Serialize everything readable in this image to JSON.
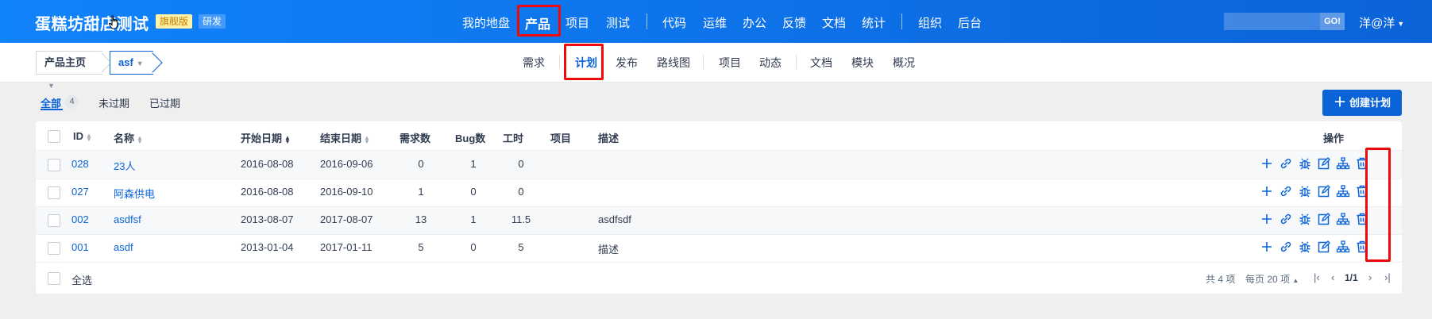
{
  "header": {
    "brand": "蛋糕坊甜店测试",
    "edition_tag": "旗舰版",
    "mode_tag": "研发",
    "nav": [
      {
        "label": "我的地盘"
      },
      {
        "label": "产品",
        "active": true
      },
      {
        "label": "项目"
      },
      {
        "label": "测试"
      },
      {
        "label": "代码"
      },
      {
        "label": "运维"
      },
      {
        "label": "办公"
      },
      {
        "label": "反馈"
      },
      {
        "label": "文档"
      },
      {
        "label": "统计"
      },
      {
        "label": "组织"
      },
      {
        "label": "后台"
      }
    ],
    "search_value": "",
    "search_button": "GO!",
    "user": "洋@洋"
  },
  "breadcrumb": {
    "product_home": "产品主页",
    "product_name": "asf"
  },
  "subnav": [
    {
      "label": "需求"
    },
    {
      "label": "计划",
      "active": true
    },
    {
      "label": "发布"
    },
    {
      "label": "路线图"
    },
    {
      "label": "项目"
    },
    {
      "label": "动态"
    },
    {
      "label": "文档"
    },
    {
      "label": "模块"
    },
    {
      "label": "概况"
    }
  ],
  "filters": {
    "all": "全部",
    "all_count": "4",
    "unexpired": "未过期",
    "expired": "已过期",
    "create_button": "创建计划"
  },
  "table": {
    "columns": [
      "ID",
      "名称",
      "开始日期",
      "结束日期",
      "需求数",
      "Bug数",
      "工时",
      "项目",
      "描述",
      "操作"
    ],
    "rows": [
      {
        "id": "028",
        "name": "23人",
        "start": "2016-08-08",
        "end": "2016-09-06",
        "stories": "0",
        "bugs": "1",
        "hours": "0",
        "project": "",
        "desc": ""
      },
      {
        "id": "027",
        "name": "阿森供电",
        "start": "2016-08-08",
        "end": "2016-09-10",
        "stories": "1",
        "bugs": "0",
        "hours": "0",
        "project": "",
        "desc": ""
      },
      {
        "id": "002",
        "name": "asdfsf",
        "start": "2013-08-07",
        "end": "2017-08-07",
        "stories": "13",
        "bugs": "1",
        "hours": "11.5",
        "project": "",
        "desc": "asdfsdf"
      },
      {
        "id": "001",
        "name": "asdf",
        "start": "2013-01-04",
        "end": "2017-01-11",
        "stories": "5",
        "bugs": "0",
        "hours": "5",
        "project": "",
        "desc": "描述"
      }
    ],
    "actions": [
      "plus-icon",
      "link-icon",
      "bug-icon",
      "edit-icon",
      "hierarchy-icon",
      "trash-icon"
    ]
  },
  "footer": {
    "select_all": "全选",
    "total": "共 4 项",
    "per_page": "每页 20 项",
    "page": "1/1"
  },
  "colors": {
    "primary": "#0b63d8",
    "highlight": "#ee0a0a"
  }
}
